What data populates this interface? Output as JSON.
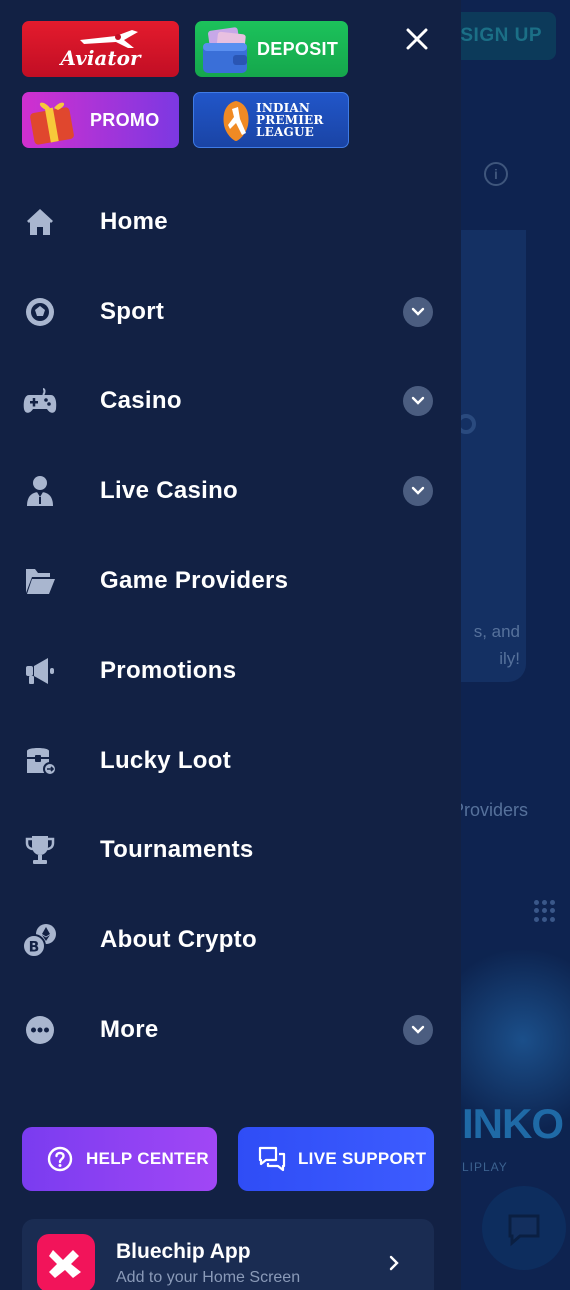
{
  "background": {
    "signup_label": "SIGN UP",
    "info_glyph": "i",
    "card_text": "s, and ily!",
    "providers_text": "Providers",
    "game_title": "INKO",
    "game_sub": "LIPLAY"
  },
  "tiles": {
    "aviator": "Aviator",
    "deposit": "DEPOSIT",
    "promo": "PROMO",
    "ipl": [
      "INDIAN",
      "PREMIER",
      "LEAGUE"
    ]
  },
  "menu": [
    {
      "label": "Home",
      "icon": "home-icon",
      "expandable": false
    },
    {
      "label": "Sport",
      "icon": "soccer-ball-icon",
      "expandable": true
    },
    {
      "label": "Casino",
      "icon": "gamepad-icon",
      "expandable": true
    },
    {
      "label": "Live Casino",
      "icon": "dealer-icon",
      "expandable": true
    },
    {
      "label": "Game Providers",
      "icon": "folder-icon",
      "expandable": false
    },
    {
      "label": "Promotions",
      "icon": "megaphone-icon",
      "expandable": false
    },
    {
      "label": "Lucky Loot",
      "icon": "treasure-chest-icon",
      "expandable": false
    },
    {
      "label": "Tournaments",
      "icon": "trophy-icon",
      "expandable": false
    },
    {
      "label": "About Crypto",
      "icon": "crypto-coins-icon",
      "expandable": false
    },
    {
      "label": "More",
      "icon": "more-dots-icon",
      "expandable": true
    }
  ],
  "buttons": {
    "help": "HELP CENTER",
    "live_support": "LIVE SUPPORT"
  },
  "app_card": {
    "title": "Bluechip App",
    "subtitle": "Add to your Home Screen"
  },
  "colors": {
    "drawer_bg": "#122144",
    "icon_color": "#a9b6cf",
    "chevron_bg": "#4b5d80",
    "help_button": "#8a42f3",
    "live_support_button": "#3553fb",
    "app_logo": "#f2145a"
  }
}
